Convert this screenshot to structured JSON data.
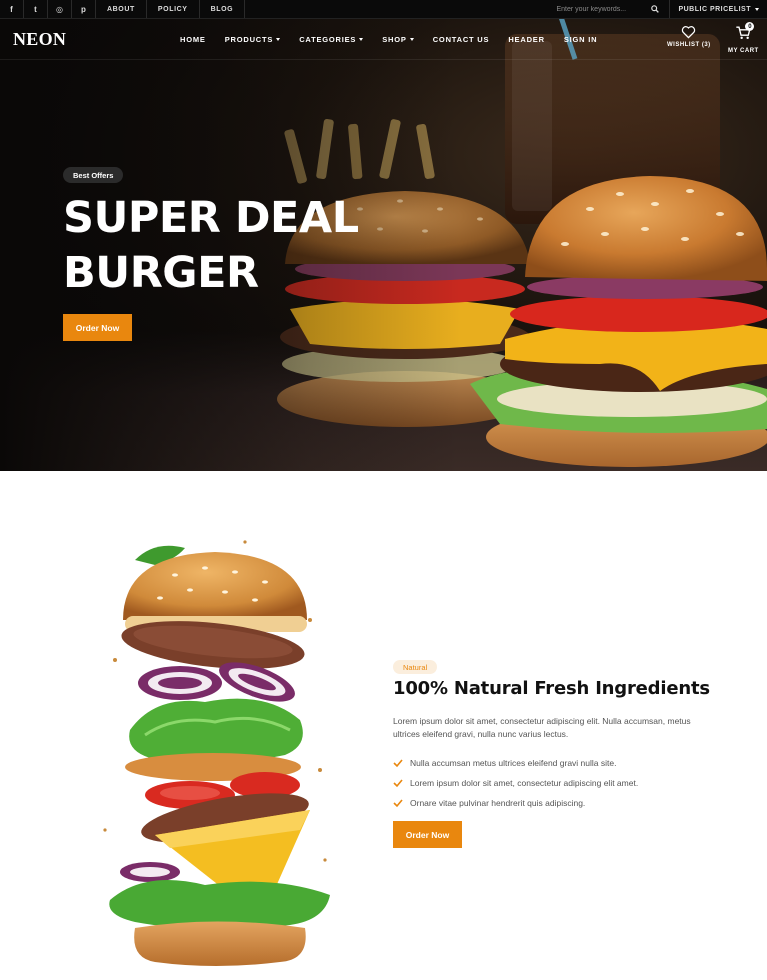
{
  "topbar": {
    "social": [
      {
        "icon": "facebook-icon",
        "glyph": "f"
      },
      {
        "icon": "twitter-icon",
        "glyph": "t"
      },
      {
        "icon": "instagram-icon",
        "glyph": "◎"
      },
      {
        "icon": "pinterest-icon",
        "glyph": "p"
      }
    ],
    "links": [
      "ABOUT",
      "POLICY",
      "BLOG"
    ],
    "search_placeholder": "Enter your keywords...",
    "pricelist_label": "PUBLIC PRICELIST"
  },
  "nav": {
    "logo": "NEON",
    "menu": [
      {
        "label": "HOME",
        "dropdown": false
      },
      {
        "label": "PRODUCTS",
        "dropdown": true
      },
      {
        "label": "CATEGORIES",
        "dropdown": true
      },
      {
        "label": "SHOP",
        "dropdown": true
      },
      {
        "label": "CONTACT US",
        "dropdown": false
      },
      {
        "label": "HEADER",
        "dropdown": false
      },
      {
        "label": "SIGN IN",
        "dropdown": false
      }
    ],
    "wishlist_label": "WISHLIST (3)",
    "cart_label": "MY CART",
    "cart_count": "0"
  },
  "hero": {
    "badge": "Best Offers",
    "title_line1": "SUPER DEAL",
    "title_line2": "BURGER",
    "button": "Order Now"
  },
  "feature": {
    "badge": "Natural",
    "title": "100% Natural Fresh Ingredients",
    "description": "Lorem ipsum dolor sit amet, consectetur adipiscing elit. Nulla accumsan, metus ultrices eleifend gravi, nulla nunc varius lectus.",
    "checklist": [
      "Nulla accumsan metus ultrices eleifend gravi nulla site.",
      "Lorem ipsum dolor sit amet, consectetur adipiscing elit amet.",
      "Ornare vitae pulvinar hendrerit quis adipiscing."
    ],
    "button": "Order Now"
  },
  "colors": {
    "accent": "#e9870e",
    "dark": "#0a0a0a",
    "badge_bg": "#fbeedd"
  }
}
